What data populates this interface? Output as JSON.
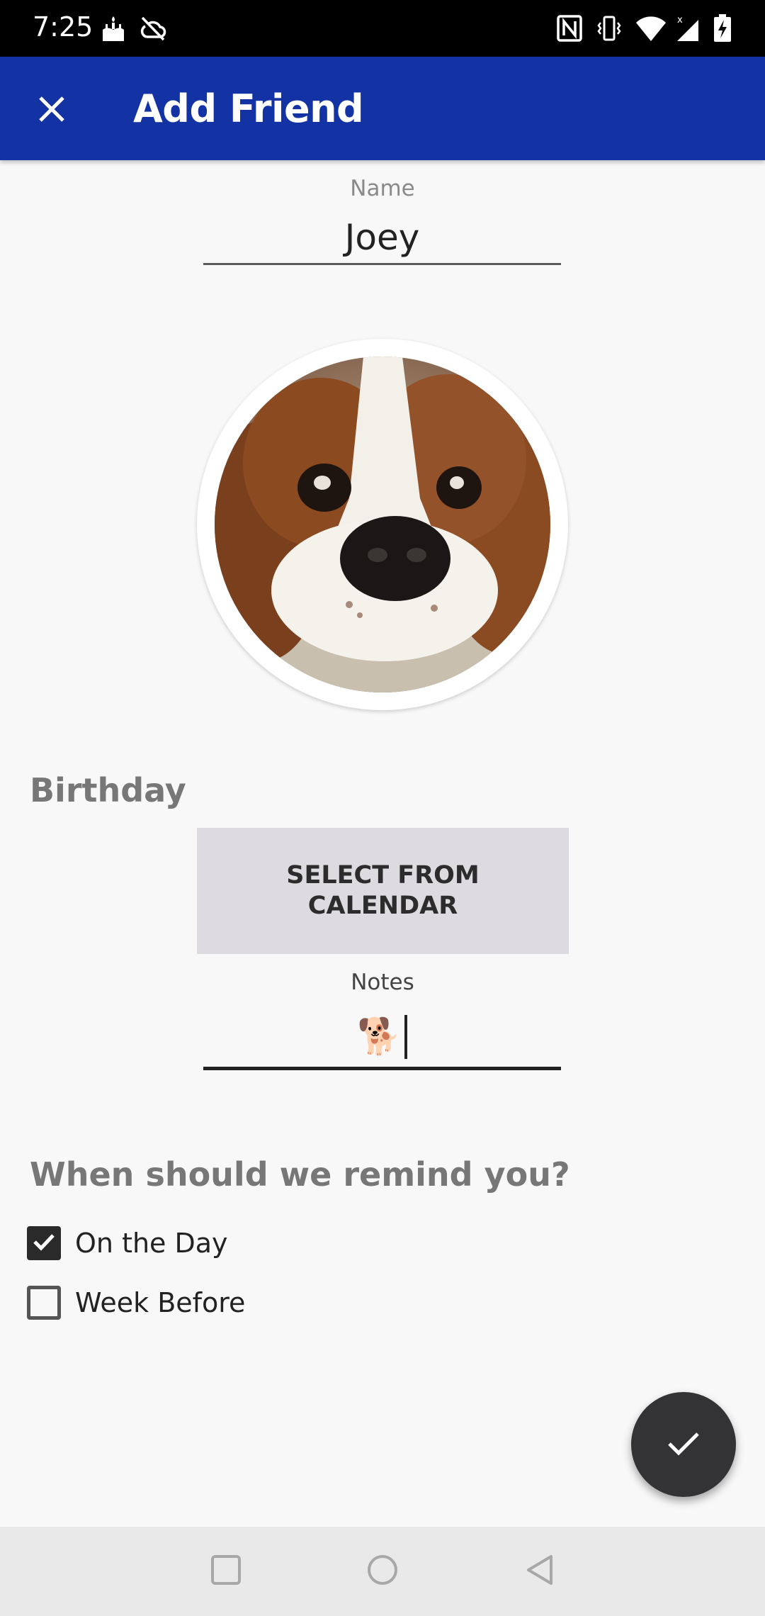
{
  "status_bar": {
    "time": "7:25",
    "icons_left": [
      "cake-icon",
      "cloud-off-icon"
    ],
    "icons_right": [
      "nfc-icon",
      "vibrate-icon",
      "wifi-icon",
      "signal-icon",
      "battery-charging-icon"
    ]
  },
  "app_bar": {
    "title": "Add Friend",
    "close_icon": "close-icon",
    "background_color": "#1332a4"
  },
  "name_field": {
    "label": "Name",
    "value": "Joey"
  },
  "avatar": {
    "description": "dog-photo"
  },
  "birthday": {
    "heading": "Birthday",
    "button_label": "SELECT FROM\nCALENDAR"
  },
  "notes_field": {
    "label": "Notes",
    "value": "🐕"
  },
  "reminders": {
    "heading": "When should we remind you?",
    "options": [
      {
        "label": "On the Day",
        "checked": true
      },
      {
        "label": "Week Before",
        "checked": false
      }
    ]
  },
  "fab": {
    "icon": "check-icon"
  },
  "nav_bar": {
    "buttons": [
      "recents-icon",
      "home-icon",
      "back-icon"
    ]
  }
}
